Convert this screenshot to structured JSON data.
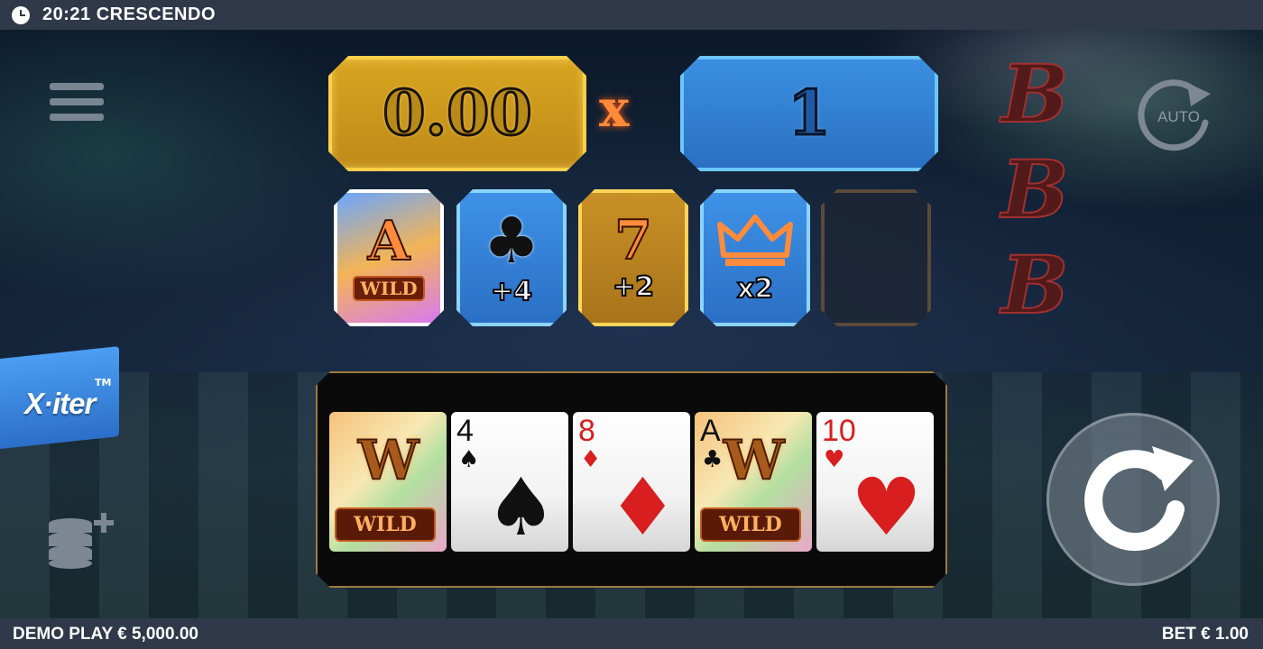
{
  "topbar": {
    "time_title": "20:21 CRESCENDO",
    "clock_icon": "clock-icon"
  },
  "bottombar": {
    "balance": "DEMO PLAY € 5,000.00",
    "bet": "BET € 1.00"
  },
  "win_meter": {
    "value": "0.00"
  },
  "multiplier_sign": "x",
  "multiplier_meter": {
    "value": "1"
  },
  "modifier_tiles": [
    {
      "symbol": "A",
      "label": "WILD"
    },
    {
      "symbol": "club-icon",
      "label": "+4"
    },
    {
      "symbol": "7",
      "label": "+2"
    },
    {
      "symbol": "crown-icon",
      "label": "x2"
    },
    {
      "symbol": "",
      "label": ""
    }
  ],
  "bonus_letters": [
    "B",
    "B",
    "B"
  ],
  "reel_cards": [
    {
      "type": "wild",
      "letter": "W",
      "label": "WILD"
    },
    {
      "rank": "4",
      "suit": "♠",
      "color": "black"
    },
    {
      "rank": "8",
      "suit": "♦",
      "color": "red"
    },
    {
      "type": "wild",
      "rank": "A",
      "suit": "♣",
      "letter": "W",
      "label": "WILD"
    },
    {
      "rank": "10",
      "suit": "♥",
      "color": "red"
    }
  ],
  "xiter": {
    "label": "X·iter",
    "tm": "TM"
  },
  "auto_button": {
    "label": "AUTO"
  },
  "colors": {
    "gold": "#ffcf4a",
    "blue": "#6bc6ff",
    "bar": "#2f3949",
    "xiter_blue": "#2b6fc9"
  }
}
